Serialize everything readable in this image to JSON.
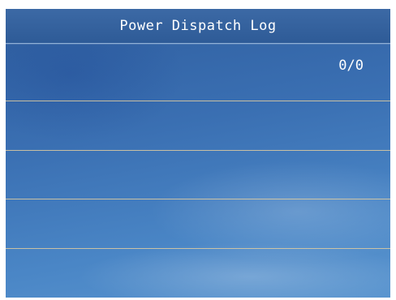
{
  "header": {
    "title": "Power Dispatch Log"
  },
  "pager": {
    "counter": "0/0"
  },
  "log": {
    "entries": [
      {
        "text": ""
      },
      {
        "text": ""
      },
      {
        "text": ""
      },
      {
        "text": ""
      }
    ]
  },
  "colors": {
    "header_bg": "#2e5b97",
    "screen_bg": "#3a6fb2",
    "divider": "#e1cda0",
    "text": "#ffffff"
  }
}
